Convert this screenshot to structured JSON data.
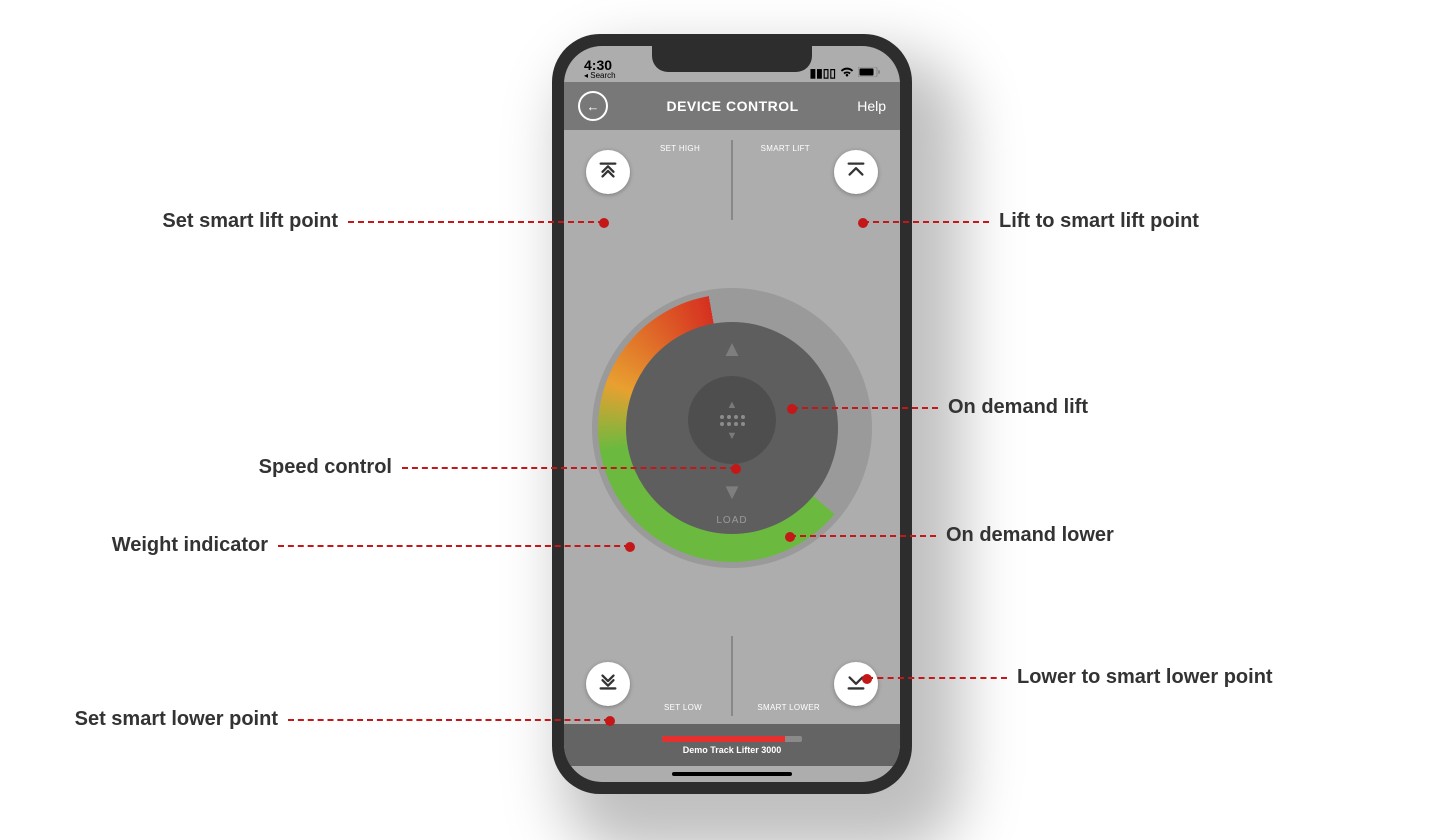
{
  "statusbar": {
    "time": "4:30",
    "back_label": "◂ Search"
  },
  "nav": {
    "title": "DEVICE CONTROL",
    "help": "Help"
  },
  "labels": {
    "set_high": "SET HIGH",
    "smart_lift": "SMART LIFT",
    "set_low": "SET LOW",
    "smart_lower": "SMART LOWER",
    "load": "LOAD"
  },
  "footer": {
    "device_name": "Demo Track Lifter 3000"
  },
  "annotations": {
    "set_smart_lift": "Set smart lift point",
    "speed_control": "Speed control",
    "weight_indicator": "Weight indicator",
    "set_smart_lower": "Set smart lower point",
    "lift_smart": "Lift to smart lift point",
    "on_demand_lift": "On demand lift",
    "on_demand_lower": "On demand lower",
    "lower_smart": "Lower to smart lower point"
  }
}
